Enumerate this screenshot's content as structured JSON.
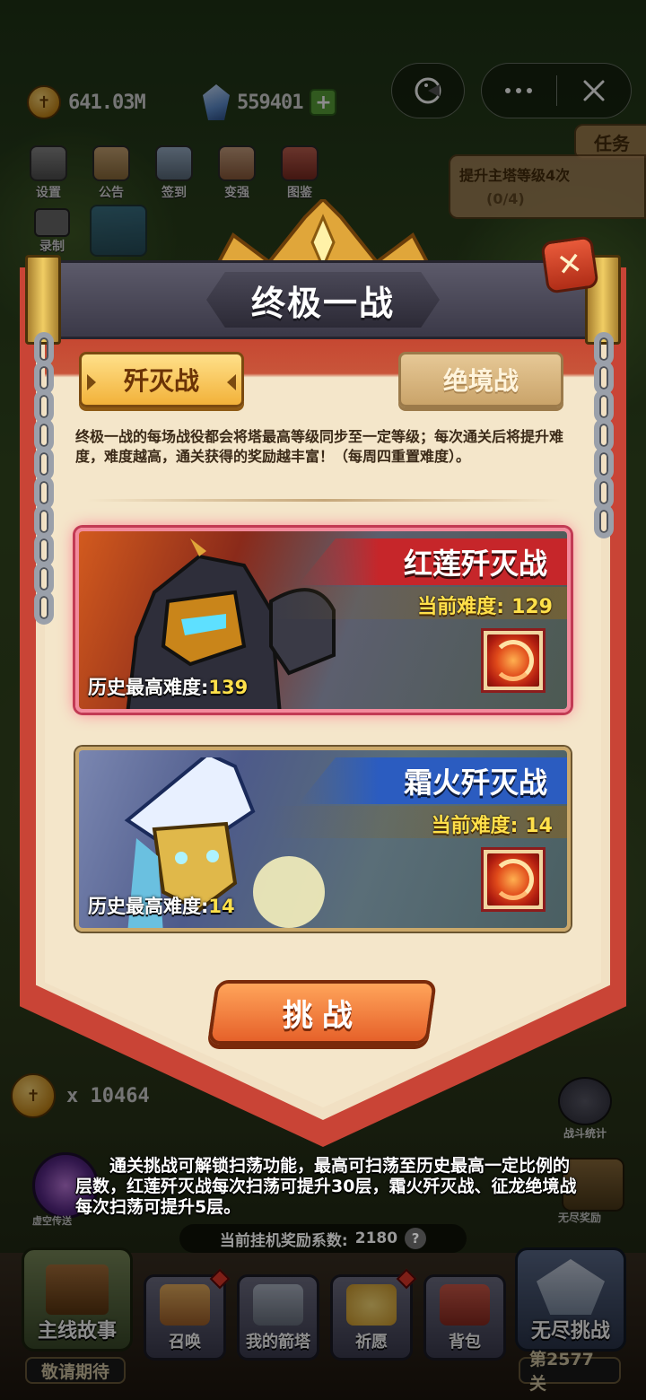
{
  "currencies": {
    "gold": "641.03M",
    "gems": "559401"
  },
  "capsule": {
    "more_label": "",
    "close_label": ""
  },
  "top_icons": [
    {
      "label": "设置",
      "icon": "gear-icon"
    },
    {
      "label": "公告",
      "icon": "scroll-icon"
    },
    {
      "label": "签到",
      "icon": "quill-icon"
    },
    {
      "label": "变强",
      "icon": "fist-icon"
    },
    {
      "label": "图鉴",
      "icon": "book-icon"
    }
  ],
  "record_label": "录制",
  "quest": {
    "tab_label": "任务",
    "title": "提升主塔等级4次",
    "progress": "(0/4)"
  },
  "modal": {
    "title": "终极一战",
    "tab_active": "歼灭战",
    "tab_inactive": "绝境战",
    "description": "终极一战的每场战役都会将塔最高等级同步至一定等级；每次通关后将提升难度，难度越高，通关获得的奖励越丰富！（每周四重置难度）。",
    "cards": [
      {
        "name": "红莲歼灭战",
        "current_label": "当前难度:",
        "current_value": "129",
        "history_label": "历史最高难度:",
        "history_value": "139",
        "theme": "red"
      },
      {
        "name": "霜火歼灭战",
        "current_label": "当前难度:",
        "current_value": "14",
        "history_label": "历史最高难度:",
        "history_value": "14",
        "theme": "blue"
      }
    ],
    "challenge_label": "挑战"
  },
  "hud": {
    "token_count": "x 10464",
    "battle_stats_label": "战斗统计",
    "portal_label": "虚空传送",
    "endless_reward_label": "无尽奖励",
    "tooltip": "通关挑战可解锁扫荡功能，最高可扫荡至历史最高一定比例的层数，红莲歼灭战每次扫荡可提升30层，霜火歼灭战、征龙绝境战每次扫荡可提升5层。",
    "idle_label": "当前挂机奖励系数:",
    "idle_value": "2180"
  },
  "nav": {
    "story": {
      "label": "主线故事",
      "sub": "敬请期待"
    },
    "items": [
      {
        "label": "召唤",
        "icon": "scroll-summon-icon",
        "dot": true
      },
      {
        "label": "我的箭塔",
        "icon": "tower-icon",
        "dot": false
      },
      {
        "label": "祈愿",
        "icon": "star-wish-icon",
        "dot": true
      },
      {
        "label": "背包",
        "icon": "backpack-icon",
        "dot": false
      }
    ],
    "endless": {
      "label": "无尽挑战",
      "sub": "第2577关"
    }
  },
  "colors": {
    "banner_red": "#c94436",
    "parchment": "#f1e0c3",
    "title_gray": "#3b3948",
    "accent_gold": "#ffe04a",
    "button_orange": "#e6612a"
  }
}
